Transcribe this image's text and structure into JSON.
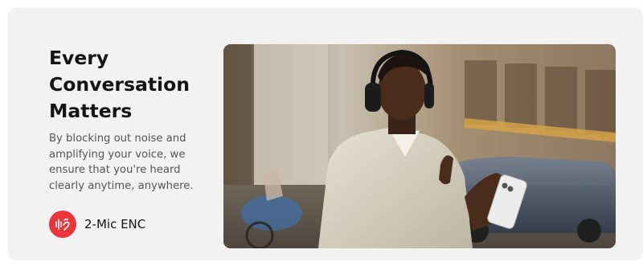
{
  "hero": {
    "headline_lines": [
      "Every",
      "Conversation",
      "Matters"
    ],
    "description": "By blocking out noise and amplifying your voice, we ensure that you're heard clearly anytime, anywhere.",
    "feature": {
      "label": "2-Mic ENC",
      "icon": "voice-waveform-icon",
      "accent_color": "#e8363a"
    }
  },
  "photo": {
    "subject": "man-wearing-headphones-icon"
  }
}
